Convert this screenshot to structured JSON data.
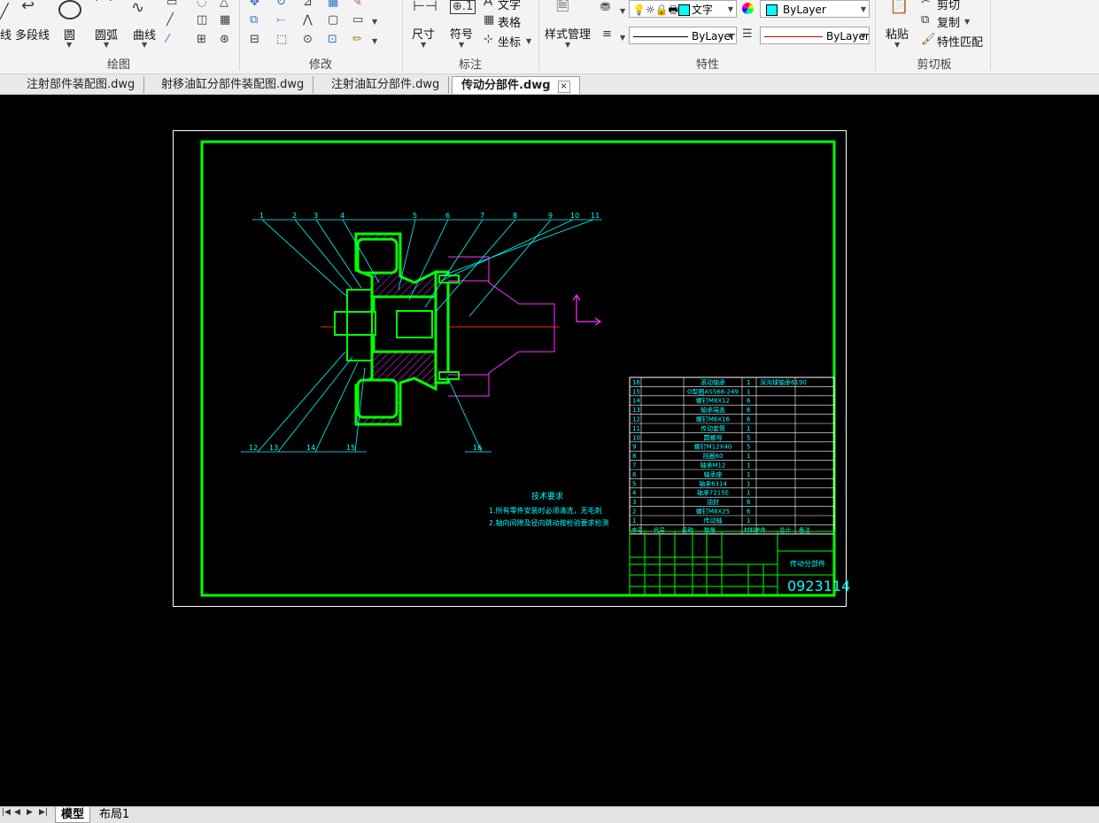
{
  "ribbon": {
    "draw": {
      "title": "绘图",
      "line_partial": "线",
      "polyline": "多段线",
      "circle": "圆",
      "arc": "圆弧",
      "curve": "曲线"
    },
    "modify": {
      "title": "修改"
    },
    "annotation": {
      "title": "标注",
      "dimension": "尺寸",
      "symbol": "符号",
      "text": "文字",
      "table": "表格",
      "coordinate": "坐标"
    },
    "properties": {
      "title": "特性",
      "style_manager": "样式管理",
      "layer_value": "文字",
      "color_value": "ByLayer",
      "linetype_value": "ByLayer",
      "lineweight_value": "ByLayer"
    },
    "clipboard": {
      "title": "剪切板",
      "paste": "粘贴",
      "cut": "剪切",
      "copy": "复制",
      "match_properties": "特性匹配"
    }
  },
  "tabs": [
    {
      "label": "注射部件装配图.dwg"
    },
    {
      "label": "射移油缸分部件装配图.dwg"
    },
    {
      "label": "注射油缸分部件.dwg"
    },
    {
      "label": "传动分部件.dwg",
      "active": true,
      "close": "×"
    }
  ],
  "layout_tabs": [
    {
      "label": "模型",
      "active": true
    },
    {
      "label": "布局1"
    }
  ],
  "drawing": {
    "leader_top": [
      "1",
      "2",
      "3",
      "4",
      "5",
      "6",
      "7",
      "8",
      "9",
      "10",
      "11"
    ],
    "leader_bottom": [
      "12",
      "13",
      "14",
      "15",
      "16"
    ],
    "tech_title": "技术要求",
    "tech_lines": [
      "1.所有零件安装时必须清洗，无毛刺",
      "2.轴向间隙及径向跳动按检验要求检测"
    ],
    "bom_rows": [
      {
        "no": "16",
        "name": "滚动轴承",
        "qty": "1",
        "note": "深沟球轴承6190"
      },
      {
        "no": "15",
        "name": "O型圈AS568-249",
        "qty": "1",
        "note": ""
      },
      {
        "no": "14",
        "name": "螺钉M8X12",
        "qty": "6",
        "note": ""
      },
      {
        "no": "13",
        "name": "轴承端盖",
        "qty": "6",
        "note": ""
      },
      {
        "no": "12",
        "name": "螺钉M6X16",
        "qty": "6",
        "note": ""
      },
      {
        "no": "11",
        "name": "传动套筒",
        "qty": "1",
        "note": ""
      },
      {
        "no": "10",
        "name": "圆螺母",
        "qty": "5",
        "note": ""
      },
      {
        "no": "9",
        "name": "螺钉M12X40",
        "qty": "5",
        "note": ""
      },
      {
        "no": "8",
        "name": "挡圈60",
        "qty": "1",
        "note": ""
      },
      {
        "no": "7",
        "name": "轴承M12",
        "qty": "1",
        "note": ""
      },
      {
        "no": "6",
        "name": "轴承座",
        "qty": "1",
        "note": ""
      },
      {
        "no": "5",
        "name": "轴承6314",
        "qty": "1",
        "note": ""
      },
      {
        "no": "4",
        "name": "轴承7215E",
        "qty": "1",
        "note": ""
      },
      {
        "no": "3",
        "name": "油封",
        "qty": "6",
        "note": ""
      },
      {
        "no": "2",
        "name": "螺钉M8X25",
        "qty": "6",
        "note": ""
      },
      {
        "no": "1",
        "name": "传动轴",
        "qty": "1",
        "note": ""
      }
    ],
    "bom_header": [
      "序号",
      "代号",
      "名称",
      "数量",
      "材料",
      "单件",
      "总计",
      "备注"
    ],
    "title_name": "传动分部件",
    "drawing_no": "0923114"
  }
}
